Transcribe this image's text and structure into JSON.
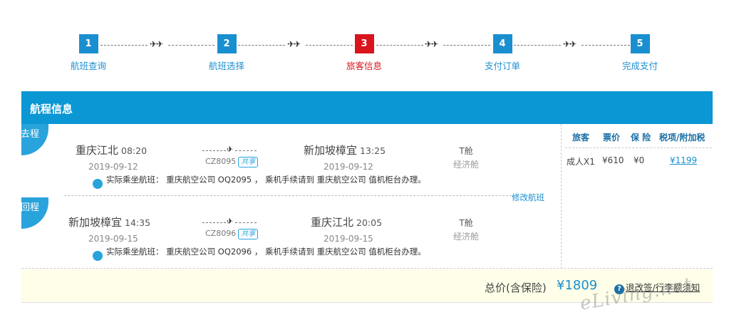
{
  "steps": [
    {
      "num": "1",
      "label": "航班查询"
    },
    {
      "num": "2",
      "label": "航班选择"
    },
    {
      "num": "3",
      "label": "旅客信息"
    },
    {
      "num": "4",
      "label": "支付订单"
    },
    {
      "num": "5",
      "label": "完成支付"
    }
  ],
  "connector_glyph": "✈✈",
  "header": {
    "title": "航程信息"
  },
  "outbound": {
    "tag": "去程",
    "from_city": "重庆江北",
    "from_time": "08:20",
    "from_date": "2019-09-12",
    "to_city": "新加坡樟宜",
    "to_time": "13:25",
    "to_date": "2019-09-12",
    "flight_no": "CZ8095",
    "share": "共享",
    "cabin": "T舱",
    "cabin_class": "经济舱",
    "note": "实际乘坐航班： 重庆航空公司 OQ2095 ， 乘机手续请到 重庆航空公司 值机柜台办理。"
  },
  "return": {
    "tag": "回程",
    "from_city": "新加坡樟宜",
    "from_time": "14:35",
    "from_date": "2019-09-15",
    "to_city": "重庆江北",
    "to_time": "20:05",
    "to_date": "2019-09-15",
    "flight_no": "CZ8096",
    "share": "共享",
    "cabin": "T舱",
    "cabin_class": "经济舱",
    "note": "实际乘坐航班： 重庆航空公司 OQ2096 ， 乘机手续请到 重庆航空公司 值机柜台办理。"
  },
  "modify_label": "修改航班",
  "price_table": {
    "headers": [
      "旅客",
      "票价",
      "保 险",
      "税项/附加税"
    ],
    "row": [
      "成人X1",
      "¥610",
      "¥0",
      "¥1199"
    ]
  },
  "footer": {
    "total_label": "总价(含保险)",
    "total_value": "¥1809",
    "help_label": "退改签/行李额须知"
  },
  "watermark": "eLiving.net",
  "colors": {
    "accent": "#1a8fd0",
    "active": "#d9141d",
    "header_bg": "#0b96d4",
    "footer_bg": "#fffee8"
  }
}
